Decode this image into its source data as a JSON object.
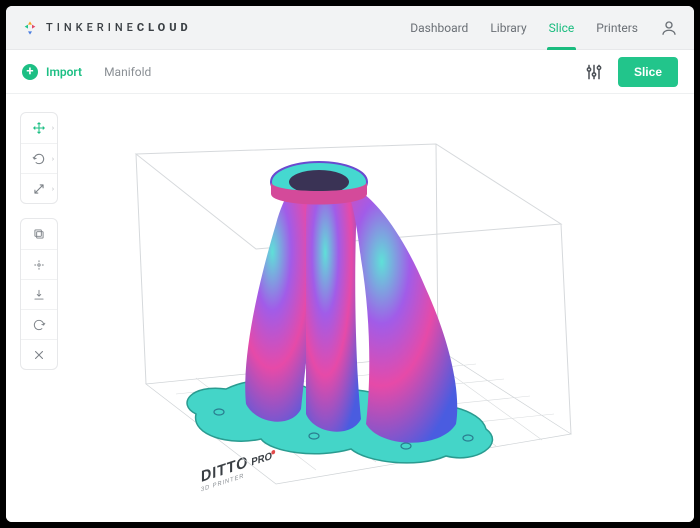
{
  "brand": {
    "name": "TINKERINE",
    "suffix": "CLOUD"
  },
  "nav": {
    "dashboard": "Dashboard",
    "library": "Library",
    "slice": "Slice",
    "printers": "Printers"
  },
  "actionbar": {
    "import_label": "Import",
    "filename": "Manifold",
    "slice_button": "Slice"
  },
  "scene": {
    "printer_label_main": "DITTO",
    "printer_label_sub": "PRO",
    "printer_label_tag": "3D PRINTER"
  },
  "colors": {
    "accent": "#1dbf84",
    "text_muted": "#8a8f94"
  }
}
